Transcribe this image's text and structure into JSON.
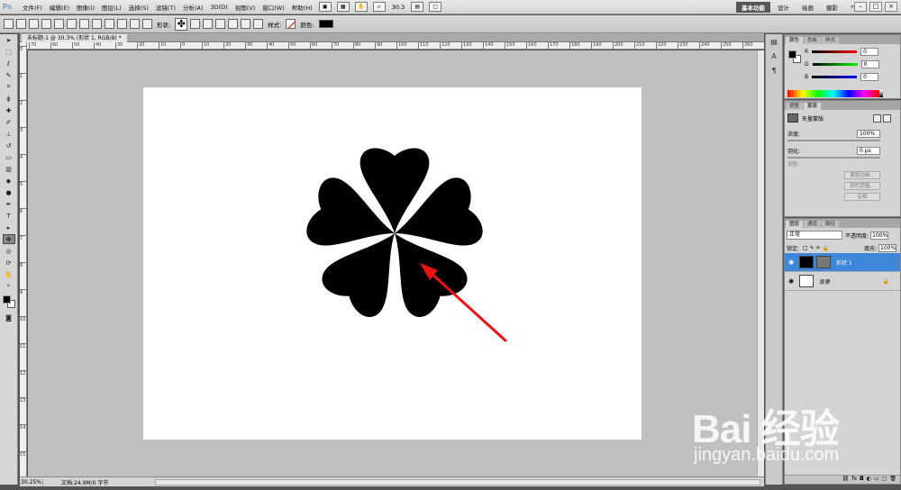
{
  "menubar": {
    "logo": "Ps",
    "items": [
      "文件(F)",
      "编辑(E)",
      "图像(I)",
      "图层(L)",
      "选择(S)",
      "滤镜(T)",
      "分析(A)",
      "3D(D)",
      "视图(V)",
      "窗口(W)",
      "帮助(H)"
    ],
    "zoom": "30.3",
    "workspace": [
      "基本功能",
      "设计",
      "绘画",
      "摄影"
    ],
    "window_controls": [
      "–",
      "□",
      "×"
    ]
  },
  "optbar": {
    "shape_label": "形状:",
    "style_label": "样式:",
    "color_label": "颜色:"
  },
  "document": {
    "tab_title": "未标题-1 @ 30.3% (形状 1, RGB/8) *",
    "ruler_top": [
      "70",
      "60",
      "50",
      "40",
      "30",
      "20",
      "10",
      "0",
      "10",
      "20",
      "30",
      "40",
      "50",
      "60",
      "70",
      "80",
      "90",
      "100",
      "110",
      "120",
      "130",
      "140",
      "150",
      "160",
      "170",
      "180",
      "190",
      "200",
      "210",
      "220",
      "230",
      "240",
      "250",
      "260"
    ],
    "ruler_left": [
      "0",
      "1",
      "2",
      "3",
      "4",
      "5",
      "6",
      "7",
      "8",
      "9",
      "10",
      "11",
      "12",
      "13",
      "14",
      "15"
    ],
    "zoom_status": "30.25%",
    "status_text": "文档:24.9M/0 字节"
  },
  "color_panel": {
    "tabs": [
      "颜色",
      "色板",
      "样式"
    ],
    "channels": [
      {
        "label": "R",
        "value": "0"
      },
      {
        "label": "G",
        "value": "0"
      },
      {
        "label": "B",
        "value": "0"
      }
    ]
  },
  "mask_panel": {
    "tabs": [
      "调整",
      "蒙版"
    ],
    "title": "矢量蒙版",
    "density_label": "浓度:",
    "density_value": "100%",
    "feather_label": "羽化:",
    "feather_value": "0 px",
    "refine_label": "调整:",
    "btn_edge": "蒙版边缘...",
    "btn_color_range": "颜色范围...",
    "btn_invert": "反相"
  },
  "layers_panel": {
    "tabs": [
      "图层",
      "通道",
      "路径"
    ],
    "blend_mode": "正常",
    "opacity_label": "不透明度:",
    "opacity_value": "100%",
    "lock_label": "锁定:",
    "fill_label": "填充:",
    "fill_value": "100%",
    "layers": [
      {
        "name": "形状 1",
        "selected": true
      },
      {
        "name": "背景",
        "selected": false
      }
    ]
  },
  "watermark": {
    "main": "Bai 经验",
    "sub": "jingyan.baidu.com"
  },
  "colors": {
    "arrow": "#ee1111",
    "selection": "#3d86d9"
  }
}
